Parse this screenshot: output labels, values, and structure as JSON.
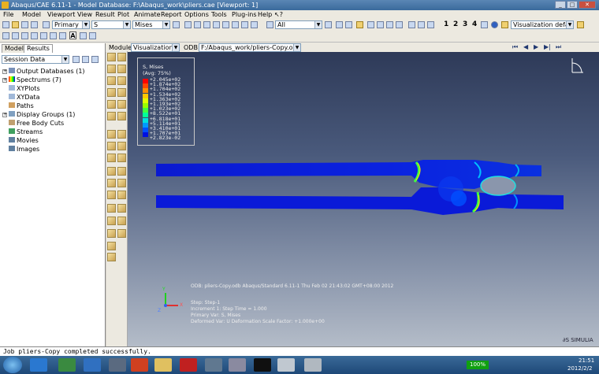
{
  "title_bar": {
    "title": "Abaqus/CAE 6.11-1 - Model Database: F:\\Abaqus_work\\pliers.cae [Viewport: 1]"
  },
  "menu": [
    "File",
    "Model",
    "Viewport",
    "View",
    "Result",
    "Plot",
    "Animate",
    "Report",
    "Options",
    "Tools",
    "Plug-ins",
    "Help"
  ],
  "toolbar": {
    "step_combo": "Primary",
    "var_combo": "S",
    "comp_combo": "Mises",
    "pick_combo": "All",
    "view_numbers": [
      "1",
      "2",
      "3",
      "4"
    ],
    "vis_defaults": "Visualization defaults"
  },
  "context": {
    "module_label": "Module:",
    "module_value": "Visualization",
    "odb_label": "ODB:",
    "odb_value": "F:/Abaqus_work/pliers-Copy.odb"
  },
  "tabs": [
    "Model",
    "Results"
  ],
  "left_panel": {
    "session_combo": "Session Data",
    "tree": [
      {
        "label": "Output Databases (1)",
        "expandable": true
      },
      {
        "label": "Spectrums (7)",
        "expandable": true
      },
      {
        "label": "XYPlots",
        "expandable": false
      },
      {
        "label": "XYData",
        "expandable": false
      },
      {
        "label": "Paths",
        "expandable": false
      },
      {
        "label": "Display Groups (1)",
        "expandable": true
      },
      {
        "label": "Free Body Cuts",
        "expandable": false
      },
      {
        "label": "Streams",
        "expandable": false
      },
      {
        "label": "Movies",
        "expandable": false
      },
      {
        "label": "Images",
        "expandable": false
      }
    ]
  },
  "legend": {
    "title": "S, Mises",
    "subtitle": "(Avg: 75%)",
    "values": [
      "+2.045e+02",
      "+1.874e+02",
      "+1.704e+02",
      "+1.534e+02",
      "+1.363e+02",
      "+1.193e+02",
      "+1.023e+02",
      "+8.522e+01",
      "+6.818e+01",
      "+5.114e+01",
      "+3.410e+01",
      "+1.707e+01",
      "+2.823e-02"
    ],
    "colors": [
      "#ff0000",
      "#ff4800",
      "#ff9000",
      "#ffc800",
      "#e0ff00",
      "#98ff00",
      "#40ff40",
      "#00ff98",
      "#00e0e0",
      "#0098ff",
      "#0050ff",
      "#0010e0"
    ]
  },
  "viewport_info": {
    "line1": "ODB: pliers-Copy.odb    Abaqus/Standard 6.11-1    Thu Feb 02 21:43:02 GMT+08:00 2012",
    "line2": "Step: Step-1",
    "line3": "Increment     1: Step Time =    1.000",
    "line4": "Primary Var: S, Mises",
    "line5": "Deformed Var: U   Deformation Scale Factor: +1.000e+00",
    "axis_y": "Y",
    "axis_x": "X",
    "axis_z": "Z",
    "brand": "SIMULIA"
  },
  "message": "Job pliers-Copy completed successfully.",
  "taskbar": {
    "zoom": "100%",
    "time": "21:51",
    "date": "2012/2/2"
  }
}
